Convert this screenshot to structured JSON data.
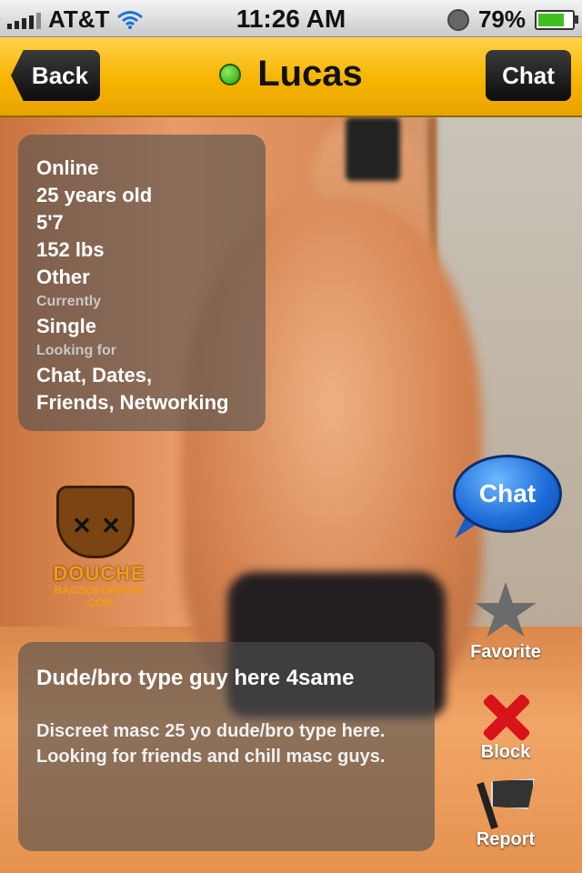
{
  "status_bar": {
    "carrier": "AT&T",
    "time": "11:26 AM",
    "battery": "79%",
    "battery_level": 0.79
  },
  "nav": {
    "back_label": "Back",
    "title": "Lucas",
    "chat_label": "Chat",
    "online_color": "#3cc31c"
  },
  "profile": {
    "lines": {
      "status": "Online",
      "age": "25 years old",
      "height": "5'7",
      "weight": "152 lbs",
      "ethnicity": "Other",
      "currently_label": "Currently",
      "relationship": "Single",
      "looking_for_label": "Looking for",
      "looking_for_1": "Chat, Dates,",
      "looking_for_2": "Friends, Networking"
    }
  },
  "watermark": {
    "line1": "DOUCHE",
    "line2": "BAGSOFGRINDR",
    "line3": ".COM"
  },
  "actions": {
    "chat": "Chat",
    "favorite": "Favorite",
    "block": "Block",
    "report": "Report"
  },
  "about": {
    "heading": "Dude/bro type guy here 4same",
    "description": "Discreet masc 25 yo dude/bro type here. Looking for friends and chill masc guys."
  },
  "icons": {
    "wifi": "wifi-icon",
    "clock": "clock-icon",
    "battery": "battery-icon",
    "favorite": "star-icon",
    "block": "x-icon",
    "report": "flag-icon"
  }
}
